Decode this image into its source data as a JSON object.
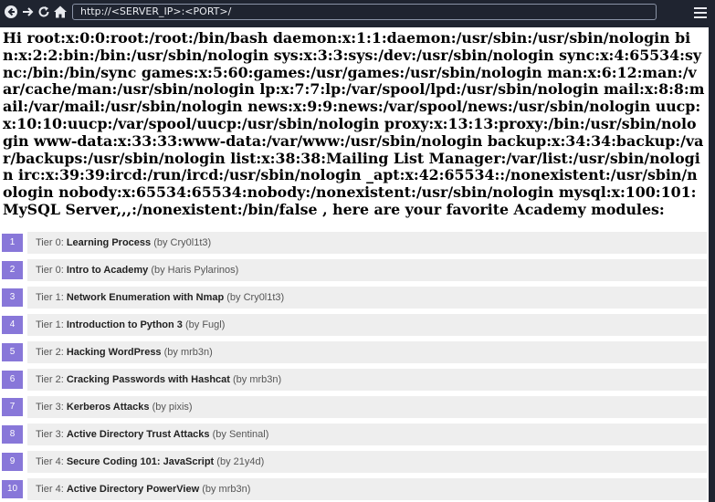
{
  "browser": {
    "url": "http://<SERVER_IP>:<PORT>/",
    "back_icon": "◀",
    "forward_icon": "→",
    "reload_icon": "⟳",
    "home_icon": "⌂"
  },
  "page": {
    "greeting": "Hi root:x:0:0:root:/root:/bin/bash daemon:x:1:1:daemon:/usr/sbin:/usr/sbin/nologin bin:x:2:2:bin:/bin:/usr/sbin/nologin sys:x:3:3:sys:/dev:/usr/sbin/nologin sync:x:4:65534:sync:/bin:/bin/sync games:x:5:60:games:/usr/games:/usr/sbin/nologin man:x:6:12:man:/var/cache/man:/usr/sbin/nologin lp:x:7:7:lp:/var/spool/lpd:/usr/sbin/nologin mail:x:8:8:mail:/var/mail:/usr/sbin/nologin news:x:9:9:news:/var/spool/news:/usr/sbin/nologin uucp:x:10:10:uucp:/var/spool/uucp:/usr/sbin/nologin proxy:x:13:13:proxy:/bin:/usr/sbin/nologin www-data:x:33:33:www-data:/var/www:/usr/sbin/nologin backup:x:34:34:backup:/var/backups:/usr/sbin/nologin list:x:38:38:Mailing List Manager:/var/list:/usr/sbin/nologin irc:x:39:39:ircd:/run/ircd:/usr/sbin/nologin _apt:x:42:65534::/nonexistent:/usr/sbin/nologin nobody:x:65534:65534:nobody:/nonexistent:/usr/sbin/nologin mysql:x:100:101:MySQL Server,,,:/nonexistent:/bin/false , here are your favorite Academy modules:"
  },
  "modules": [
    {
      "num": "1",
      "tier": "Tier 0: ",
      "title": "Learning Process",
      "author": " (by Cry0l1t3)"
    },
    {
      "num": "2",
      "tier": "Tier 0: ",
      "title": "Intro to Academy",
      "author": " (by Haris Pylarinos)"
    },
    {
      "num": "3",
      "tier": "Tier 1: ",
      "title": "Network Enumeration with Nmap",
      "author": " (by Cry0l1t3)"
    },
    {
      "num": "4",
      "tier": "Tier 1: ",
      "title": "Introduction to Python 3",
      "author": " (by Fugl)"
    },
    {
      "num": "5",
      "tier": "Tier 2: ",
      "title": "Hacking WordPress",
      "author": " (by mrb3n)"
    },
    {
      "num": "6",
      "tier": "Tier 2: ",
      "title": "Cracking Passwords with Hashcat",
      "author": " (by mrb3n)"
    },
    {
      "num": "7",
      "tier": "Tier 3: ",
      "title": "Kerberos Attacks",
      "author": " (by pixis)"
    },
    {
      "num": "8",
      "tier": "Tier 3: ",
      "title": "Active Directory Trust Attacks",
      "author": " (by Sentinal)"
    },
    {
      "num": "9",
      "tier": "Tier 4: ",
      "title": "Secure Coding 101: JavaScript",
      "author": " (by 21y4d)"
    },
    {
      "num": "10",
      "tier": "Tier 4: ",
      "title": "Active Directory PowerView",
      "author": " (by mrb3n)"
    }
  ],
  "colors": {
    "chrome": "#1f2430",
    "badge": "#8877d9",
    "row": "#eeeeee"
  }
}
